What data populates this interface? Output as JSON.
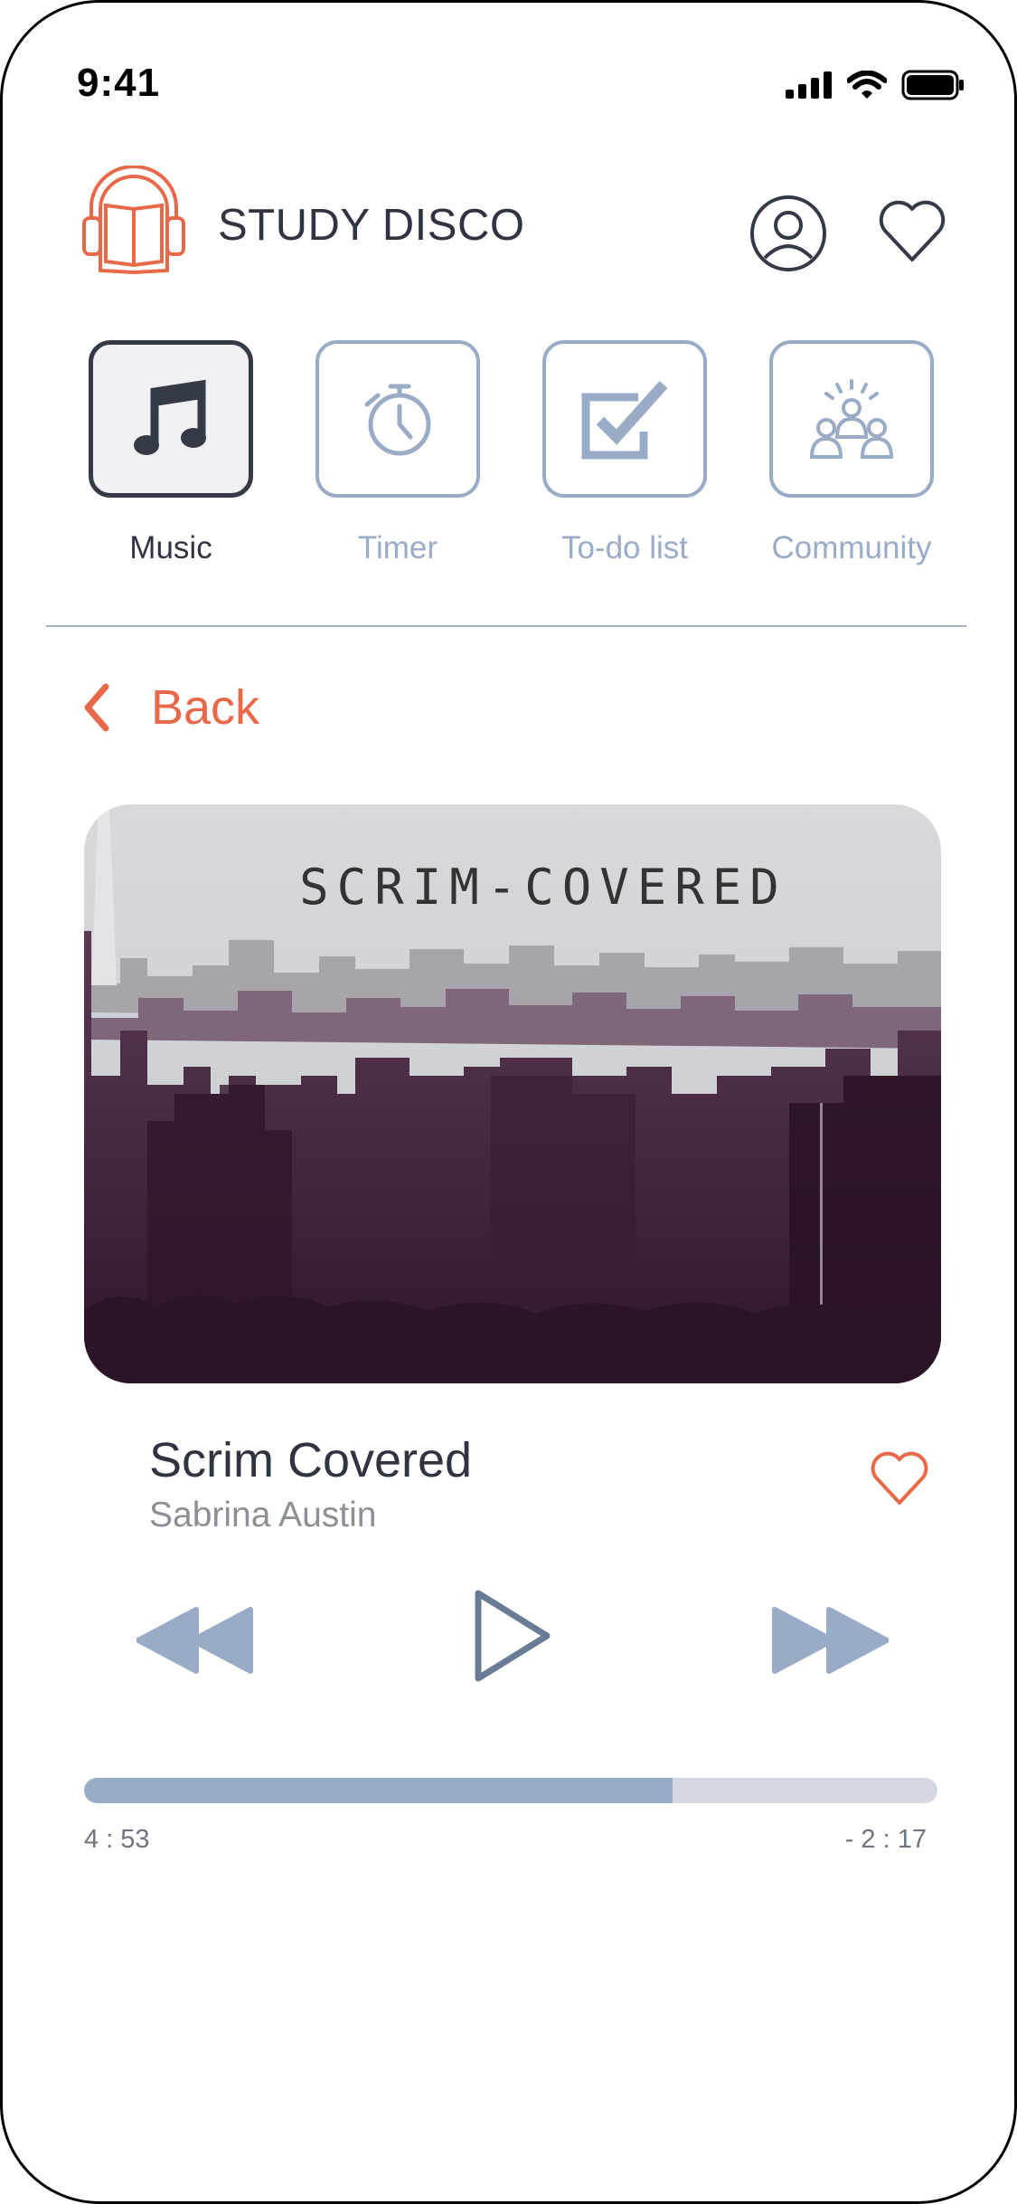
{
  "status_bar": {
    "time": "9:41"
  },
  "header": {
    "app_name": "STUDY DISCO"
  },
  "nav": {
    "items": [
      {
        "label": "Music",
        "active": true
      },
      {
        "label": "Timer",
        "active": false
      },
      {
        "label": "To-do list",
        "active": false
      },
      {
        "label": "Community",
        "active": false
      }
    ]
  },
  "back": {
    "label": "Back"
  },
  "player": {
    "cover_text": "SCRIM-COVERED",
    "title": "Scrim Covered",
    "artist": "Sabrina Austin",
    "elapsed": "4 : 53",
    "remaining": "- 2 : 17",
    "progress": 0.69
  },
  "colors": {
    "accent": "#e8694a",
    "muted": "#9aabc6",
    "dark": "#353a47",
    "cover_dark": "#3f1f3b"
  },
  "icons": {
    "logo": "headphones-book-icon",
    "user": "user-circle-icon",
    "favorite": "heart-icon",
    "music": "music-note-icon",
    "timer": "stopwatch-icon",
    "todo": "checkbox-icon",
    "community": "people-group-icon",
    "back": "chevron-left-icon",
    "prev": "rewind-icon",
    "play": "play-icon",
    "next": "fast-forward-icon"
  }
}
